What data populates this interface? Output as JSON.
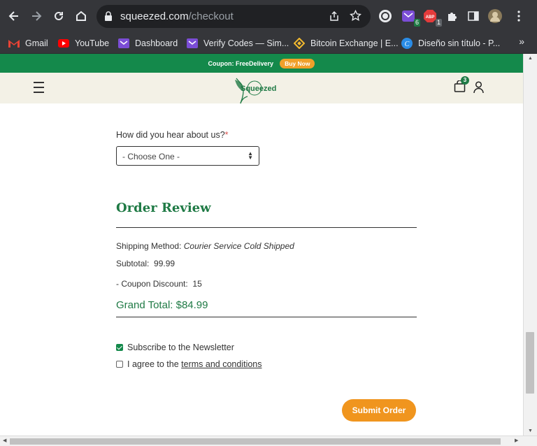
{
  "browser": {
    "url_host": "squeezed.com",
    "url_path": "/checkout",
    "extensions": {
      "mail_badge": "6",
      "abp_badge": "1"
    }
  },
  "bookmarks": [
    {
      "label": "Gmail",
      "icon": "gmail-icon"
    },
    {
      "label": "YouTube",
      "icon": "youtube-icon"
    },
    {
      "label": "Dashboard",
      "icon": "mail-icon"
    },
    {
      "label": "Verify Codes — Sim...",
      "icon": "mail-icon"
    },
    {
      "label": "Bitcoin Exchange | E...",
      "icon": "binance-icon"
    },
    {
      "label": "Diseño sin título - P...",
      "icon": "canva-icon"
    }
  ],
  "promo": {
    "text": "Coupon: FreeDelivery",
    "button": "Buy Now"
  },
  "header": {
    "logo_text": "Squeezed",
    "cart_count": "3"
  },
  "form": {
    "question": "How did you hear about us?",
    "required_mark": "*",
    "select_value": "- Choose One -"
  },
  "order_review": {
    "title": "Order Review",
    "shipping_label": "Shipping Method:",
    "shipping_value": "Courier Service Cold Shipped",
    "subtotal_label": "Subtotal:",
    "subtotal_value": "99.99",
    "discount_label": "- Coupon Discount:",
    "discount_value": "15",
    "grand_total": "Grand Total: $84.99"
  },
  "options": {
    "newsletter_label": "Subscribe to the Newsletter",
    "newsletter_checked": true,
    "terms_prefix": "I agree to the",
    "terms_link": "terms and conditions",
    "terms_checked": false
  },
  "submit_label": "Submit Order",
  "colors": {
    "brand_green": "#14894b",
    "accent_orange": "#f0951e",
    "header_bg": "#f3f1e6"
  }
}
